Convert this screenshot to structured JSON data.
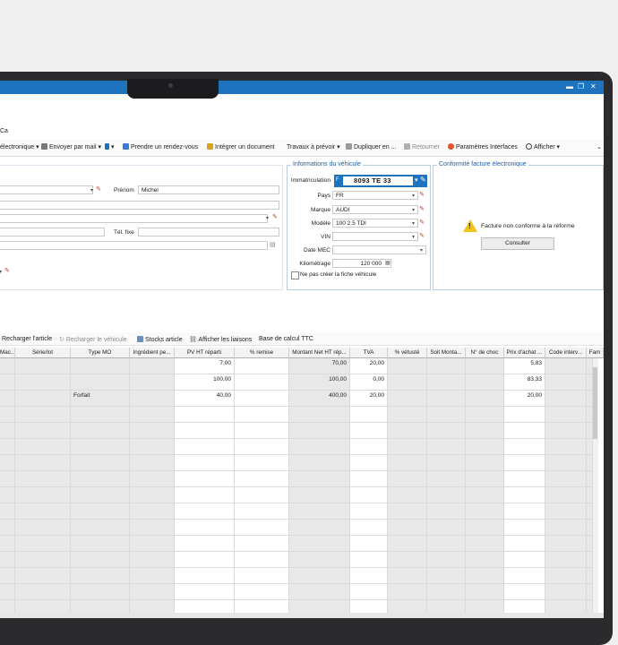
{
  "window": {
    "minimize": "▬",
    "restore": "❐",
    "close": "✕"
  },
  "menu": {
    "partial_label": "Ca"
  },
  "toolbar": {
    "items": [
      {
        "label": "électronique ▾",
        "icon": "document-icon",
        "color": "#3a7bd5"
      },
      {
        "label": "Envoyer par mail ▾",
        "icon": "mail-icon",
        "color": "#7a7a7a"
      },
      {
        "label": "▾",
        "icon": "phone-icon",
        "color": "#1e73be"
      },
      {
        "label": "Prendre un rendez-vous",
        "icon": "calendar-icon",
        "color": "#3a7bd5"
      },
      {
        "label": "Intégrer un document",
        "icon": "folder-icon",
        "color": "#e0a020"
      },
      {
        "label": "Travaux à prévoir ▾",
        "icon": "",
        "color": ""
      },
      {
        "label": "Dupliquer en ...",
        "icon": "duplicate-icon",
        "color": "#555555"
      },
      {
        "label": "Retourner",
        "icon": "return-icon",
        "color": "#9a9a9a"
      },
      {
        "label": "Paramètres Interfaces",
        "icon": "settings-icon",
        "color": "#e2552f"
      },
      {
        "label": "Afficher ▾",
        "icon": "search-icon",
        "color": "#444444"
      }
    ]
  },
  "client": {
    "prenom_label": "Prénom",
    "prenom_value": "Michel",
    "tel_label": "Tél. fixe",
    "tel_value": ""
  },
  "vehicle": {
    "legend": "Informations du véhicule",
    "immat_label": "Immatriculation",
    "immat_value": "8093 TE 33",
    "pays_label": "Pays",
    "pays_value": "FR",
    "marque_label": "Marque",
    "marque_value": "AUDI",
    "modele_label": "Modèle",
    "modele_value": "100 2.5 TDI",
    "vin_label": "VIN",
    "vin_value": "",
    "mec_label": "Date MEC",
    "mec_value": "",
    "km_label": "Kilométrage",
    "km_value": "120 000",
    "nocreate_label": "Ne pas créer la fiche véhicule"
  },
  "conformite": {
    "legend": "Conformité facture électronique",
    "message": "Facture non conforme à la réforme",
    "button": "Consulter"
  },
  "grid_toolbar": {
    "recharger_article": "Recharger l'article",
    "recharger_vehicule": "Recharger le véhicule",
    "stocks": "Stocks article",
    "liaisons": "Afficher les liaisons",
    "base_ttc": "Base de calcul TTC"
  },
  "table": {
    "columns": [
      "Mac...",
      "Série/lot",
      "Type MO",
      "Ingrédient pe...",
      "PV HT réparti",
      "% remise",
      "Montant Net HT rép...",
      "TVA",
      "% vétusté",
      "Soit Monta...",
      "N° de choc",
      "Prix d'achat ...",
      "Code interv...",
      "Fam"
    ],
    "rows": [
      {
        "type_mo": "",
        "pv": "7,00",
        "montant": "70,00",
        "tva": "20,00",
        "prix": "5,83"
      },
      {
        "type_mo": "",
        "pv": "100,00",
        "montant": "100,00",
        "tva": "0,00",
        "prix": "83,33"
      },
      {
        "type_mo": "Forfait",
        "pv": "40,00",
        "montant": "400,00",
        "tva": "20,00",
        "prix": "20,00"
      }
    ]
  }
}
